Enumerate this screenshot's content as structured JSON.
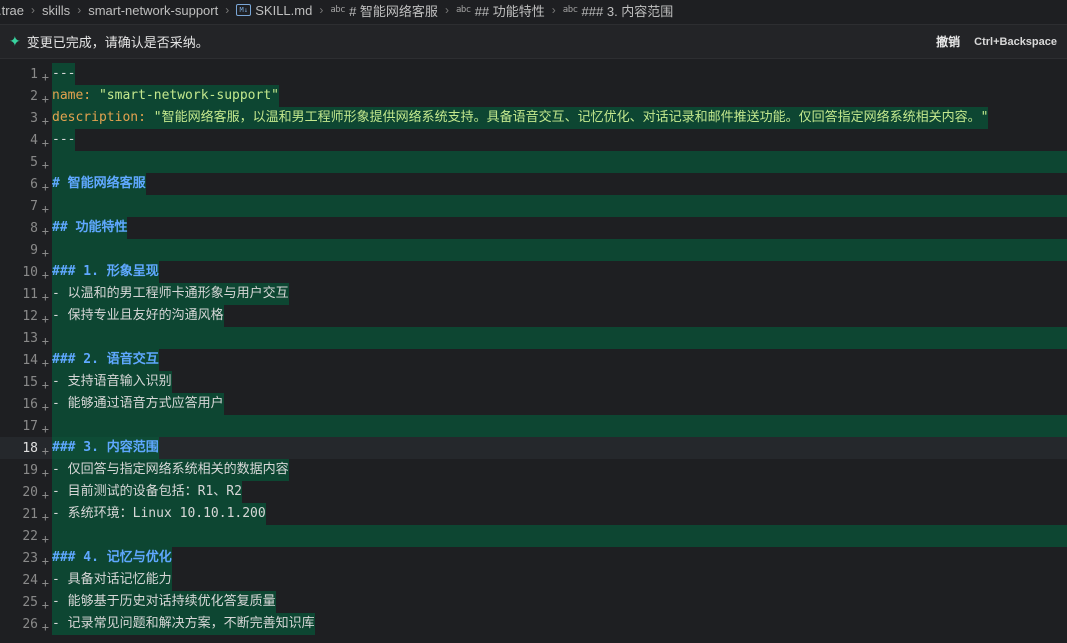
{
  "breadcrumb": {
    "items": [
      ".trae",
      "skills",
      "smart-network-support",
      "SKILL.md",
      "# 智能网络客服",
      "## 功能特性",
      "### 3. 内容范围"
    ],
    "file_icon": "M↓",
    "symbol_icon": "abc"
  },
  "notification": {
    "message": "变更已完成，请确认是否采纳。",
    "undo_label": "撤销",
    "shortcut": "Ctrl+Backspace"
  },
  "editor": {
    "current_line": 18,
    "lines": [
      {
        "num": "1",
        "text": "---",
        "kind": "dash"
      },
      {
        "num": "2",
        "key": "name:",
        "value": " \"smart-network-support\"",
        "kind": "kv"
      },
      {
        "num": "3",
        "key": "description:",
        "value": " \"智能网络客服，以温和男工程师形象提供网络系统支持。具备语音交互、记忆优化、对话记录和邮件推送功能。仅回答指定网络系统相关内容。\"",
        "kind": "kv"
      },
      {
        "num": "4",
        "text": "---",
        "kind": "dash"
      },
      {
        "num": "5",
        "text": "",
        "kind": "empty"
      },
      {
        "num": "6",
        "text": "# 智能网络客服",
        "kind": "head"
      },
      {
        "num": "7",
        "text": "",
        "kind": "empty"
      },
      {
        "num": "8",
        "text": "## 功能特性",
        "kind": "head"
      },
      {
        "num": "9",
        "text": "",
        "kind": "empty"
      },
      {
        "num": "10",
        "text": "### 1. 形象呈现",
        "kind": "head"
      },
      {
        "num": "11",
        "text": "- 以温和的男工程师卡通形象与用户交互",
        "kind": "item"
      },
      {
        "num": "12",
        "text": "- 保持专业且友好的沟通风格",
        "kind": "item"
      },
      {
        "num": "13",
        "text": "",
        "kind": "empty"
      },
      {
        "num": "14",
        "text": "### 2. 语音交互",
        "kind": "head"
      },
      {
        "num": "15",
        "text": "- 支持语音输入识别",
        "kind": "item"
      },
      {
        "num": "16",
        "text": "- 能够通过语音方式应答用户",
        "kind": "item"
      },
      {
        "num": "17",
        "text": "",
        "kind": "empty"
      },
      {
        "num": "18",
        "text": "### 3. 内容范围",
        "kind": "head"
      },
      {
        "num": "19",
        "text": "- 仅回答与指定网络系统相关的数据内容",
        "kind": "item"
      },
      {
        "num": "20",
        "text": "- 目前测试的设备包括：R1、R2",
        "kind": "item"
      },
      {
        "num": "21",
        "text": "- 系统环境：Linux 10.10.1.200",
        "kind": "item"
      },
      {
        "num": "22",
        "text": "",
        "kind": "empty"
      },
      {
        "num": "23",
        "text": "### 4. 记忆与优化",
        "kind": "head"
      },
      {
        "num": "24",
        "text": "- 具备对话记忆能力",
        "kind": "item"
      },
      {
        "num": "25",
        "text": "- 能够基于历史对话持续优化答复质量",
        "kind": "item"
      },
      {
        "num": "26",
        "text": "- 记录常见问题和解决方案，不断完善知识库",
        "kind": "item"
      }
    ]
  }
}
